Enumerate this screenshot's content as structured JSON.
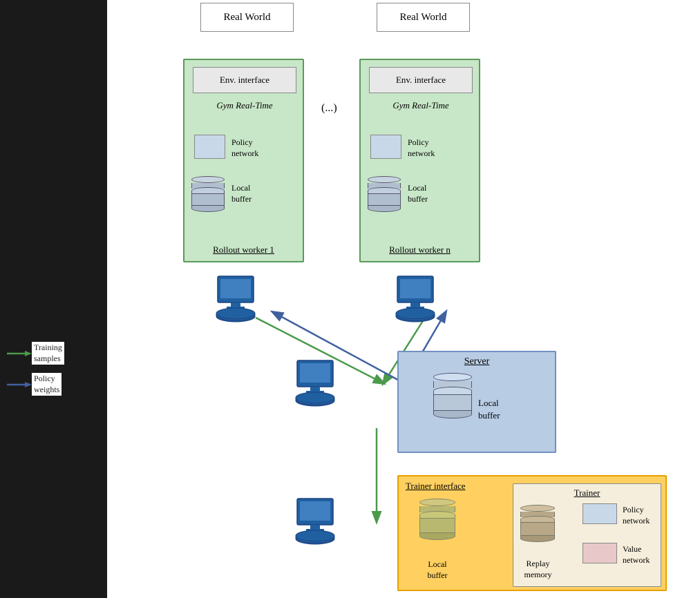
{
  "realWorld": {
    "label": "Real World"
  },
  "ellipsis": "(...)",
  "worker1": {
    "label": "Rollout worker 1",
    "envInterface": "Env. interface",
    "gymLabel": "Gym Real-Time",
    "policyLabel": "Policy\nnetwork",
    "bufferLabel": "Local\nbuffer"
  },
  "worker2": {
    "label": "Rollout worker n",
    "envInterface": "Env. interface",
    "gymLabel": "Gym Real-Time",
    "policyLabel": "Policy\nnetwork",
    "bufferLabel": "Local\nbuffer"
  },
  "server": {
    "label": "Server",
    "bufferLabel": "Local\nbuffer"
  },
  "trainerInterface": {
    "label": "Trainer interface",
    "bufferLabel": "Local\nbuffer"
  },
  "trainer": {
    "label": "Trainer",
    "replayLabel": "Replay\nmemory",
    "policyLabel": "Policy\nnetwork",
    "valueLabel": "Value\nnetwork"
  },
  "legend": {
    "trainingSamples": "Training\nsamples",
    "policyWeights": "Policy\nweights"
  },
  "colors": {
    "green": "#4a9a4a",
    "blue": "#4060a0",
    "workerBorder": "#5a9a5a",
    "workerBg": "#c8e6c8",
    "serverBorder": "#7090c0",
    "serverBg": "#b8cce4",
    "trainerBorder": "#e8a000",
    "trainerBg": "#ffd060"
  }
}
